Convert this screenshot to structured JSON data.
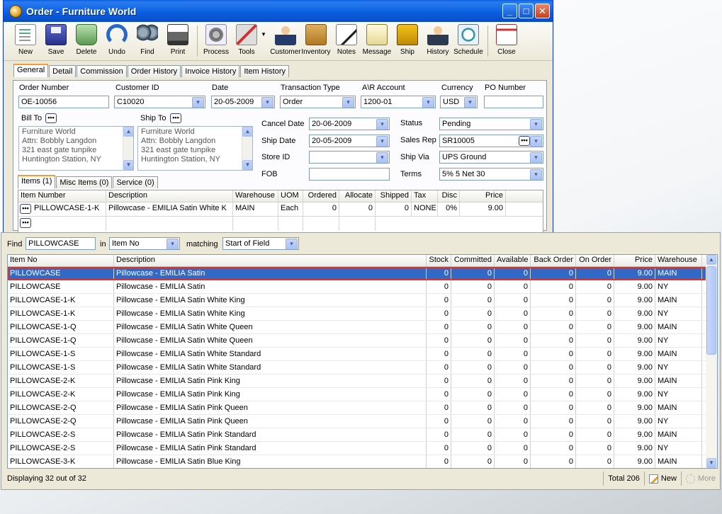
{
  "window": {
    "title": "Order - Furniture World",
    "controls": {
      "minimize": "_",
      "maximize": "□",
      "close": "✕"
    }
  },
  "toolbar": {
    "buttons": [
      {
        "label": "New",
        "icon": "new-document-icon"
      },
      {
        "label": "Save",
        "icon": "floppy-disk-icon"
      },
      {
        "label": "Delete",
        "icon": "trash-can-icon"
      },
      {
        "label": "Undo",
        "icon": "undo-arrow-icon"
      },
      {
        "label": "Find",
        "icon": "binoculars-icon"
      },
      {
        "label": "Print",
        "icon": "printer-icon"
      },
      {
        "label": "Process",
        "icon": "gears-icon"
      },
      {
        "label": "Tools",
        "icon": "tools-icon"
      },
      {
        "label": "Customer",
        "icon": "customer-person-icon"
      },
      {
        "label": "Inventory",
        "icon": "boxes-icon"
      },
      {
        "label": "Notes",
        "icon": "notepad-pen-icon"
      },
      {
        "label": "Message",
        "icon": "message-sheet-icon"
      },
      {
        "label": "Ship",
        "icon": "forklift-icon"
      },
      {
        "label": "History",
        "icon": "history-person-icon"
      },
      {
        "label": "Schedule",
        "icon": "schedule-clock-icon"
      },
      {
        "label": "Close",
        "icon": "close-window-icon"
      }
    ]
  },
  "tabs": [
    "General",
    "Detail",
    "Commission",
    "Order History",
    "Invoice History",
    "Item History"
  ],
  "form": {
    "order_number": {
      "label": "Order Number",
      "value": "OE-10056"
    },
    "customer_id": {
      "label": "Customer ID",
      "value": "C10020"
    },
    "date": {
      "label": "Date",
      "value": "20-05-2009"
    },
    "transaction_type": {
      "label": "Transaction Type",
      "value": "Order"
    },
    "ar_account": {
      "label": "A\\R Account",
      "value": "1200-01"
    },
    "currency": {
      "label": "Currency",
      "value": "USD"
    },
    "po_number": {
      "label": "PO Number",
      "value": ""
    },
    "bill_to": {
      "label": "Bill To",
      "lines": [
        "Furniture World",
        "Attn: Bobbly Langdon",
        "321 east gate tunpike",
        "Huntington Station, NY"
      ]
    },
    "ship_to": {
      "label": "Ship To",
      "lines": [
        "Furniture World",
        "Attn: Bobbly Langdon",
        "321 east gate tunpike",
        "Huntington Station, NY"
      ]
    },
    "cancel_date": {
      "label": "Cancel  Date",
      "value": "20-06-2009"
    },
    "ship_date": {
      "label": "Ship Date",
      "value": "20-05-2009"
    },
    "store_id": {
      "label": "Store ID",
      "value": ""
    },
    "fob": {
      "label": "FOB",
      "value": ""
    },
    "status": {
      "label": "Status",
      "value": "Pending"
    },
    "sales_rep": {
      "label": "Sales Rep",
      "value": "SR10005"
    },
    "ship_via": {
      "label": "Ship Via",
      "value": "UPS Ground"
    },
    "terms": {
      "label": "Terms",
      "value": "5% 5 Net 30"
    }
  },
  "subtabs": [
    "Items (1)",
    "Misc Items (0)",
    "Service (0)"
  ],
  "items_grid": {
    "columns": [
      "Item Number",
      "Description",
      "Warehouse",
      "UOM",
      "Ordered",
      "Allocate",
      "Shipped",
      "Tax",
      "Disc",
      "Price"
    ],
    "row": {
      "item_number": "PILLOWCASE-1-K",
      "description": "Pillowcase - EMILIA Satin White K",
      "warehouse": "MAIN",
      "uom": "Each",
      "ordered": "0",
      "allocate": "0",
      "shipped": "0",
      "tax": "NONE",
      "disc": "0%",
      "price": "9.00"
    }
  },
  "lookup": {
    "find_label": "Find",
    "find_value": "PILLOWCASE",
    "in_label": "in",
    "in_value": "Item No",
    "matching_label": "matching",
    "matching_value": "Start of Field",
    "columns": [
      "Item No",
      "Description",
      "Stock",
      "Committed",
      "Available",
      "Back Order",
      "On Order",
      "Price",
      "Warehouse"
    ],
    "rows": [
      [
        "PILLOWCASE",
        "Pillowcase - EMILIA Satin",
        "0",
        "0",
        "0",
        "0",
        "0",
        "9.00",
        "MAIN"
      ],
      [
        "PILLOWCASE",
        "Pillowcase - EMILIA Satin",
        "0",
        "0",
        "0",
        "0",
        "0",
        "9.00",
        "NY"
      ],
      [
        "PILLOWCASE-1-K",
        "Pillowcase - EMILIA Satin White King",
        "0",
        "0",
        "0",
        "0",
        "0",
        "9.00",
        "MAIN"
      ],
      [
        "PILLOWCASE-1-K",
        "Pillowcase - EMILIA Satin White King",
        "0",
        "0",
        "0",
        "0",
        "0",
        "9.00",
        "NY"
      ],
      [
        "PILLOWCASE-1-Q",
        "Pillowcase - EMILIA Satin White Queen",
        "0",
        "0",
        "0",
        "0",
        "0",
        "9.00",
        "MAIN"
      ],
      [
        "PILLOWCASE-1-Q",
        "Pillowcase - EMILIA Satin White Queen",
        "0",
        "0",
        "0",
        "0",
        "0",
        "9.00",
        "NY"
      ],
      [
        "PILLOWCASE-1-S",
        "Pillowcase - EMILIA Satin White Standard",
        "0",
        "0",
        "0",
        "0",
        "0",
        "9.00",
        "MAIN"
      ],
      [
        "PILLOWCASE-1-S",
        "Pillowcase - EMILIA Satin White Standard",
        "0",
        "0",
        "0",
        "0",
        "0",
        "9.00",
        "NY"
      ],
      [
        "PILLOWCASE-2-K",
        "Pillowcase - EMILIA Satin Pink King",
        "0",
        "0",
        "0",
        "0",
        "0",
        "9.00",
        "MAIN"
      ],
      [
        "PILLOWCASE-2-K",
        "Pillowcase - EMILIA Satin Pink King",
        "0",
        "0",
        "0",
        "0",
        "0",
        "9.00",
        "NY"
      ],
      [
        "PILLOWCASE-2-Q",
        "Pillowcase - EMILIA Satin Pink Queen",
        "0",
        "0",
        "0",
        "0",
        "0",
        "9.00",
        "MAIN"
      ],
      [
        "PILLOWCASE-2-Q",
        "Pillowcase - EMILIA Satin Pink Queen",
        "0",
        "0",
        "0",
        "0",
        "0",
        "9.00",
        "NY"
      ],
      [
        "PILLOWCASE-2-S",
        "Pillowcase - EMILIA Satin Pink Standard",
        "0",
        "0",
        "0",
        "0",
        "0",
        "9.00",
        "MAIN"
      ],
      [
        "PILLOWCASE-2-S",
        "Pillowcase - EMILIA Satin Pink Standard",
        "0",
        "0",
        "0",
        "0",
        "0",
        "9.00",
        "NY"
      ],
      [
        "PILLOWCASE-3-K",
        "Pillowcase - EMILIA Satin Blue King",
        "0",
        "0",
        "0",
        "0",
        "0",
        "9.00",
        "MAIN"
      ]
    ],
    "selected_row": 0,
    "status_text": "Displaying 32 out of 32",
    "total_text": "Total 206",
    "new_label": "New",
    "more_label": "More"
  },
  "colors": {
    "selection": "#3169c6",
    "selection_outline": "#e03030",
    "title_bar": "#0a5ede"
  }
}
